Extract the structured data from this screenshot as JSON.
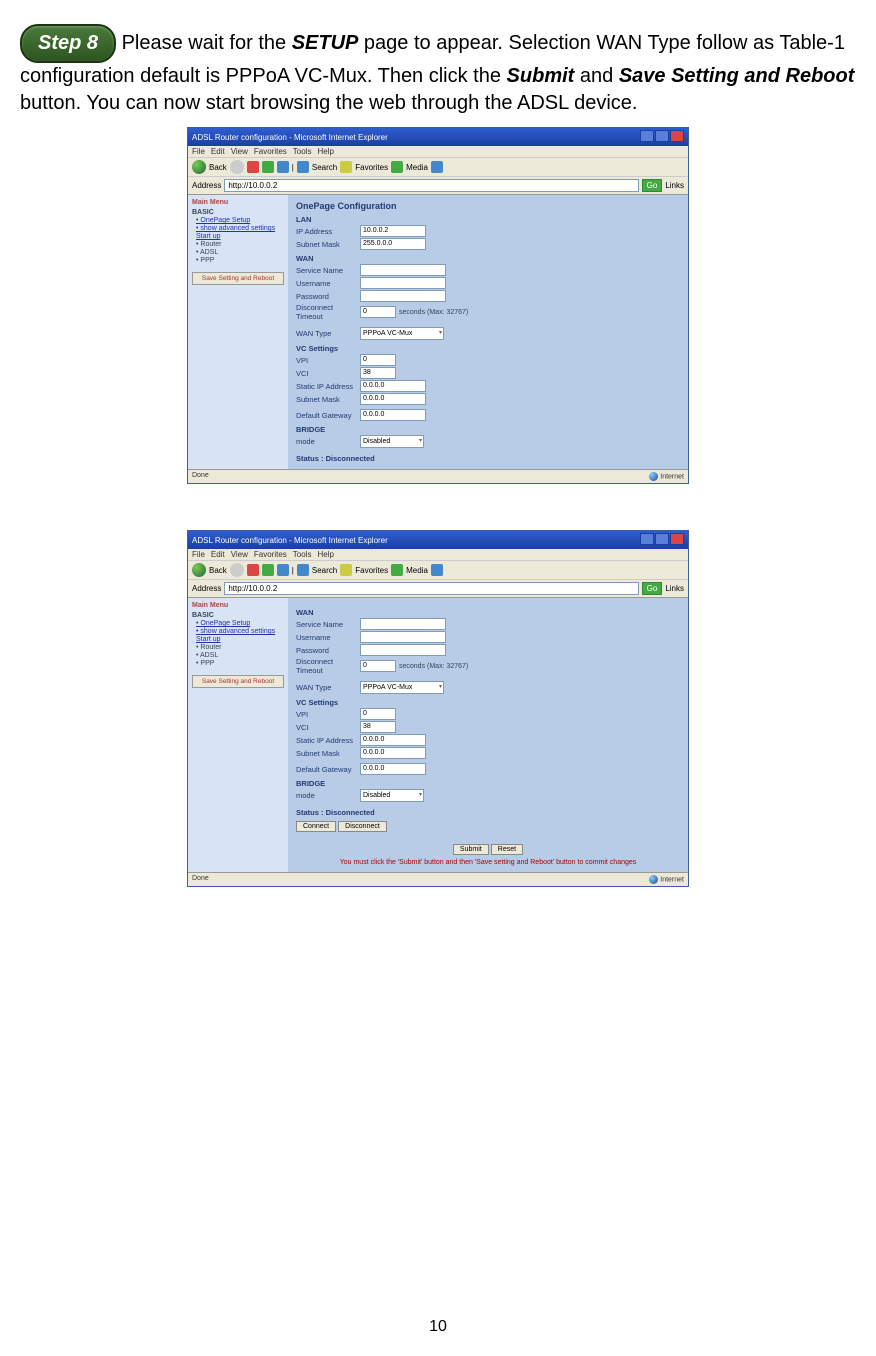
{
  "step_badge": "Step 8",
  "intro": {
    "t1": " Please wait for the ",
    "setup": "SETUP",
    "t2": " page to appear. Selection WAN Type follow as Table-1 configuration default is PPPoA VC-Mux. Then click the ",
    "submit": "Submit",
    "t3": " and ",
    "save": "Save Setting and Reboot",
    "t4": " button. You can now start browsing the web through the ADSL device."
  },
  "browser": {
    "title": "ADSL Router configuration - Microsoft Internet Explorer",
    "menu": [
      "File",
      "Edit",
      "View",
      "Favorites",
      "Tools",
      "Help"
    ],
    "back": "Back",
    "search": "Search",
    "favorites": "Favorites",
    "media": "Media",
    "address_label": "Address",
    "address": "http://10.0.0.2",
    "go": "Go",
    "links": "Links",
    "status_done": "Done",
    "status_inet": "Internet"
  },
  "sidebar": {
    "main_menu": "Main Menu",
    "basic": "BASIC",
    "onepage": "OnePage Setup",
    "adv": "show advanced settings",
    "startup": "Start up",
    "router": "Router",
    "adsl": "ADSL",
    "ppp": "PPP",
    "save_btn": "Save Setting and Reboot"
  },
  "config": {
    "title": "OnePage Configuration",
    "lan": "LAN",
    "ip_label": "IP Address",
    "ip": "10.0.0.2",
    "mask_label": "Subnet Mask",
    "mask": "255.0.0.0",
    "wan": "WAN",
    "svc_label": "Service Name",
    "user_label": "Username",
    "pwd_label": "Password",
    "disc_label": "Disconnect Timeout",
    "disc_val": "0",
    "disc_hint": "seconds (Max: 32767)",
    "wantype_label": "WAN Type",
    "wantype": "PPPoA VC-Mux",
    "vc": "VC Settings",
    "vpi_label": "VPI",
    "vpi": "0",
    "vci_label": "VCI",
    "vci": "38",
    "sip_label": "Static IP Address",
    "sip": "0.0.0.0",
    "smask_label": "Subnet Mask",
    "smask": "0.0.0.0",
    "gw_label": "Default Gateway",
    "gw": "0.0.0.0",
    "bridge": "BRIDGE",
    "mode_label": "mode",
    "mode": "Disabled",
    "status": "Status : Disconnected",
    "connect": "Connect",
    "disconnect": "Disconnect",
    "submit": "Submit",
    "reset": "Reset",
    "warn": "You must click the 'Submit' button and then 'Save setting and Reboot' button to commit changes"
  },
  "page_number": "10"
}
